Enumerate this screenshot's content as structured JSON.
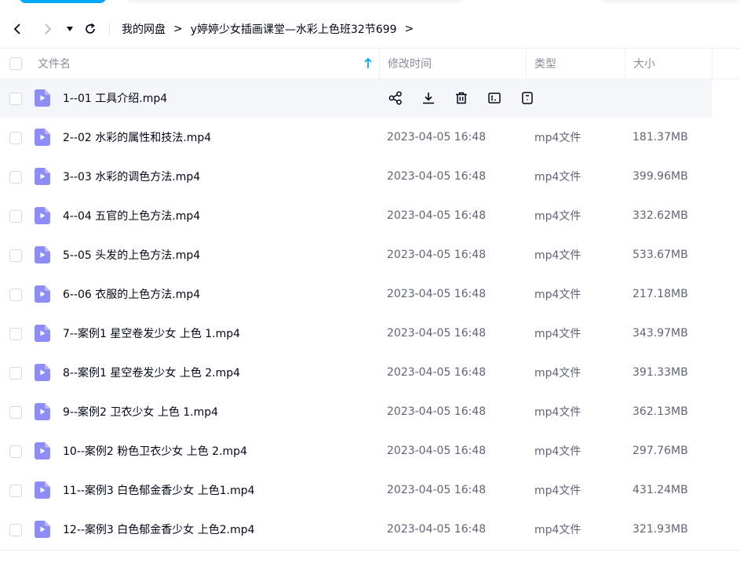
{
  "nav": {
    "breadcrumb": [
      "我的网盘",
      "y婷婷少女插画课堂—水彩上色班32节699"
    ],
    "separator": ">"
  },
  "table": {
    "headers": {
      "name": "文件名",
      "modified": "修改时间",
      "type": "类型",
      "size": "大小"
    },
    "rows": [
      {
        "name": "1--01 工具介绍.mp4",
        "modified": "",
        "type": "",
        "size": "",
        "hover": true
      },
      {
        "name": "2--02 水彩的属性和技法.mp4",
        "modified": "2023-04-05 16:48",
        "type": "mp4文件",
        "size": "181.37MB"
      },
      {
        "name": "3--03 水彩的调色方法.mp4",
        "modified": "2023-04-05 16:48",
        "type": "mp4文件",
        "size": "399.96MB"
      },
      {
        "name": "4--04 五官的上色方法.mp4",
        "modified": "2023-04-05 16:48",
        "type": "mp4文件",
        "size": "332.62MB"
      },
      {
        "name": "5--05 头发的上色方法.mp4",
        "modified": "2023-04-05 16:48",
        "type": "mp4文件",
        "size": "533.67MB"
      },
      {
        "name": "6--06 衣服的上色方法.mp4",
        "modified": "2023-04-05 16:48",
        "type": "mp4文件",
        "size": "217.18MB"
      },
      {
        "name": "7--案例1 星空卷发少女 上色 1.mp4",
        "modified": "2023-04-05 16:48",
        "type": "mp4文件",
        "size": "343.97MB"
      },
      {
        "name": "8--案例1 星空卷发少女 上色 2.mp4",
        "modified": "2023-04-05 16:48",
        "type": "mp4文件",
        "size": "391.33MB"
      },
      {
        "name": "9--案例2 卫衣少女 上色 1.mp4",
        "modified": "2023-04-05 16:48",
        "type": "mp4文件",
        "size": "362.13MB"
      },
      {
        "name": "10--案例2 粉色卫衣少女 上色 2.mp4",
        "modified": "2023-04-05 16:48",
        "type": "mp4文件",
        "size": "297.76MB"
      },
      {
        "name": "11--案例3 白色郁金香少女 上色1.mp4",
        "modified": "2023-04-05 16:48",
        "type": "mp4文件",
        "size": "431.24MB"
      },
      {
        "name": "12--案例3 白色郁金香少女 上色2.mp4",
        "modified": "2023-04-05 16:48",
        "type": "mp4文件",
        "size": "321.93MB"
      }
    ]
  },
  "hover_actions": [
    "share-icon",
    "download-icon",
    "delete-icon",
    "rename-icon",
    "more-icon"
  ],
  "colors": {
    "accent": "#06a7ff",
    "file_icon": "#8e8cf6",
    "hover_bg": "#f5f6f9"
  }
}
